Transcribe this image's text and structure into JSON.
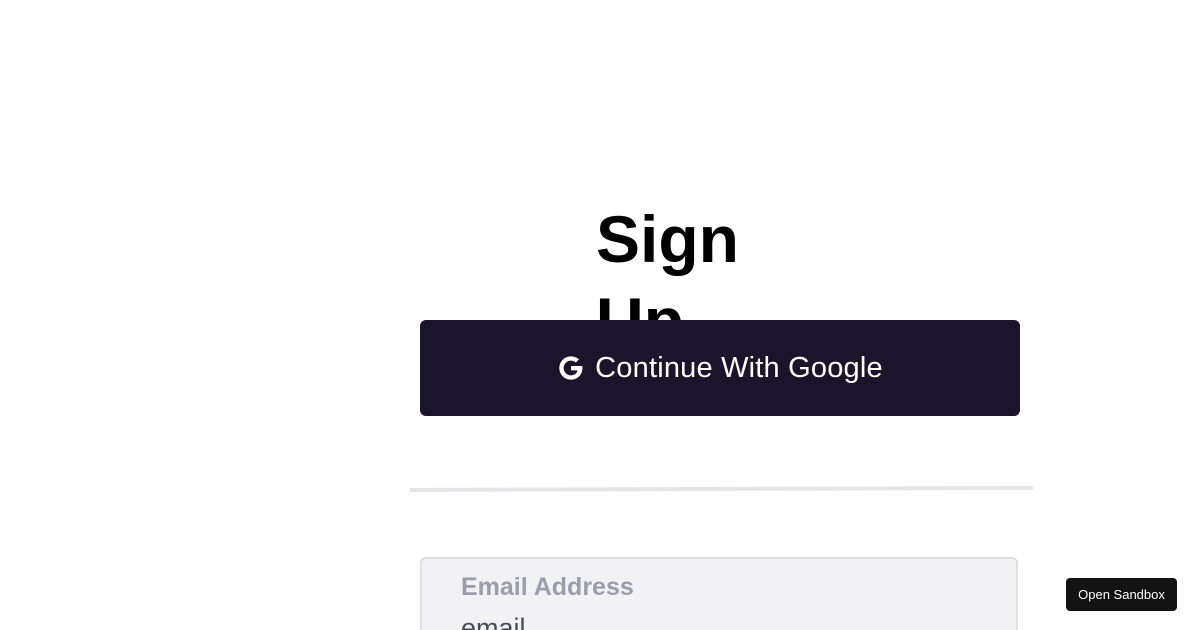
{
  "signup": {
    "title": "Sign Up",
    "google_button": {
      "label": "Continue With Google",
      "icon": "google-icon"
    },
    "email": {
      "label": "Email Address",
      "placeholder": "email"
    }
  },
  "sandbox": {
    "label": "Open Sandbox"
  },
  "colors": {
    "google_button_bg": "#1b152b",
    "email_field_bg": "#f2f2f5",
    "email_label": "#9b9dab",
    "sandbox_button_bg": "#131313"
  }
}
